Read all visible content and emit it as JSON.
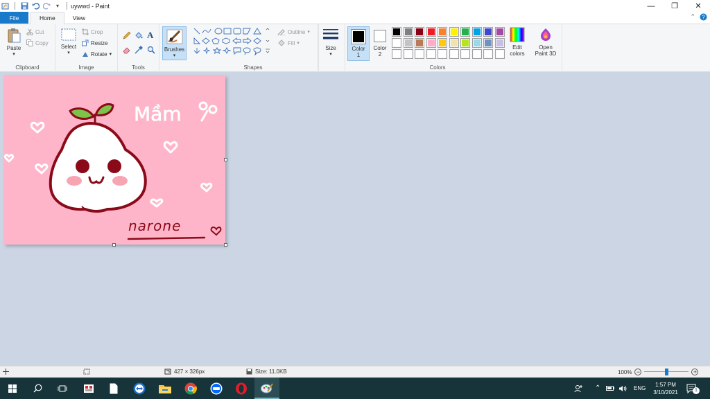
{
  "window": {
    "title": "uywwd - Paint",
    "qa_dropdown": "▾",
    "controls": {
      "minimize": "—",
      "restore": "❐",
      "close": "✕"
    }
  },
  "tabs": {
    "file": "File",
    "home": "Home",
    "view": "View"
  },
  "ribbon": {
    "clipboard": {
      "paste": "Paste",
      "cut": "Cut",
      "copy": "Copy",
      "label": "Clipboard"
    },
    "image": {
      "select": "Select",
      "crop": "Crop",
      "resize": "Resize",
      "rotate": "Rotate",
      "label": "Image"
    },
    "tools": {
      "label": "Tools"
    },
    "brushes": {
      "label": "Brushes"
    },
    "shapes": {
      "outline": "Outline",
      "fill": "Fill",
      "label": "Shapes"
    },
    "size": {
      "label": "Size"
    },
    "color1": {
      "label": "Color",
      "num": "1",
      "color": "#000000"
    },
    "color2": {
      "label": "Color",
      "num": "2",
      "color": "#ffffff"
    },
    "palette": {
      "row1": [
        "#000000",
        "#7f7f7f",
        "#880015",
        "#ed1c24",
        "#ff7f27",
        "#fff200",
        "#22b14c",
        "#00a2e8",
        "#3f48cc",
        "#a349a4"
      ],
      "row2": [
        "#ffffff",
        "#c3c3c3",
        "#b97a57",
        "#ffaec9",
        "#ffc90e",
        "#efe4b0",
        "#b5e61d",
        "#99d9ea",
        "#7092be",
        "#c8bfe7"
      ],
      "row3": [
        "#ffffff",
        "#ffffff",
        "#ffffff",
        "#ffffff",
        "#ffffff",
        "#ffffff",
        "#ffffff",
        "#ffffff",
        "#ffffff",
        "#ffffff"
      ]
    },
    "edit_colors": {
      "line1": "Edit",
      "line2": "colors"
    },
    "paint3d": {
      "line1": "Open",
      "line2": "Paint 3D"
    },
    "colors_label": "Colors"
  },
  "canvas": {
    "bg_color": "#ffb5c9",
    "title_text": "Mầm",
    "signature_text": "narone"
  },
  "statusbar": {
    "dimensions": "427 × 326px",
    "size": "Size: 11.0KB",
    "zoom": "100%",
    "zoom_level": 1.0
  },
  "taskbar": {
    "lang": "ENG",
    "time": "1:57 PM",
    "date": "3/10/2021",
    "notifications": "1"
  }
}
